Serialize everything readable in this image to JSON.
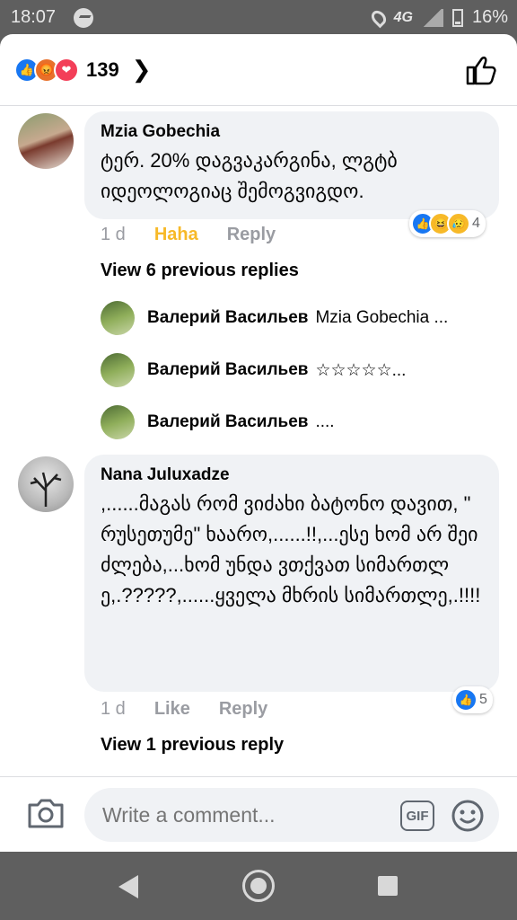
{
  "status": {
    "time": "18:07",
    "network": "4G",
    "battery": "16%"
  },
  "header": {
    "reaction_count": "139"
  },
  "comments": [
    {
      "author": "Mzia Gobechia",
      "text": "ტერ. 20% დაგვაკარგინა, ლგტბ იდეოლოგიაც შემოგვიგდო.",
      "time": "1 d",
      "action_reaction": "Haha",
      "action_reply": "Reply",
      "reaction_count": "4",
      "view_replies": "View 6 previous replies",
      "replies": [
        {
          "author": "Валерий Васильев",
          "snippet": "Mzia Gobechia ..."
        },
        {
          "author": "Валерий Васильев",
          "snippet": "☆☆☆☆☆..."
        },
        {
          "author": "Валерий Васильев",
          "snippet": "...."
        }
      ]
    },
    {
      "author": "Nana Juluxadze",
      "text": ",......მაგას რომ ვიძახი ბატონო დავით, \" რუსეთუმე\" ხაარო,......!!,...ესე ხომ არ შეიძლება,...ხომ უნდა ვთქვათ სიმართლე,.?????,......ყველა მხრის სიმართლე,.!!!!",
      "time": "1 d",
      "action_like": "Like",
      "action_reply": "Reply",
      "reaction_count": "5",
      "view_replies": "View 1 previous reply"
    }
  ],
  "composer": {
    "placeholder": "Write a comment...",
    "gif_label": "GIF"
  },
  "colors": {
    "accent": "#1877f2",
    "haha": "#f7b928",
    "bubble": "#f0f2f5",
    "muted": "#9a9ca2"
  }
}
